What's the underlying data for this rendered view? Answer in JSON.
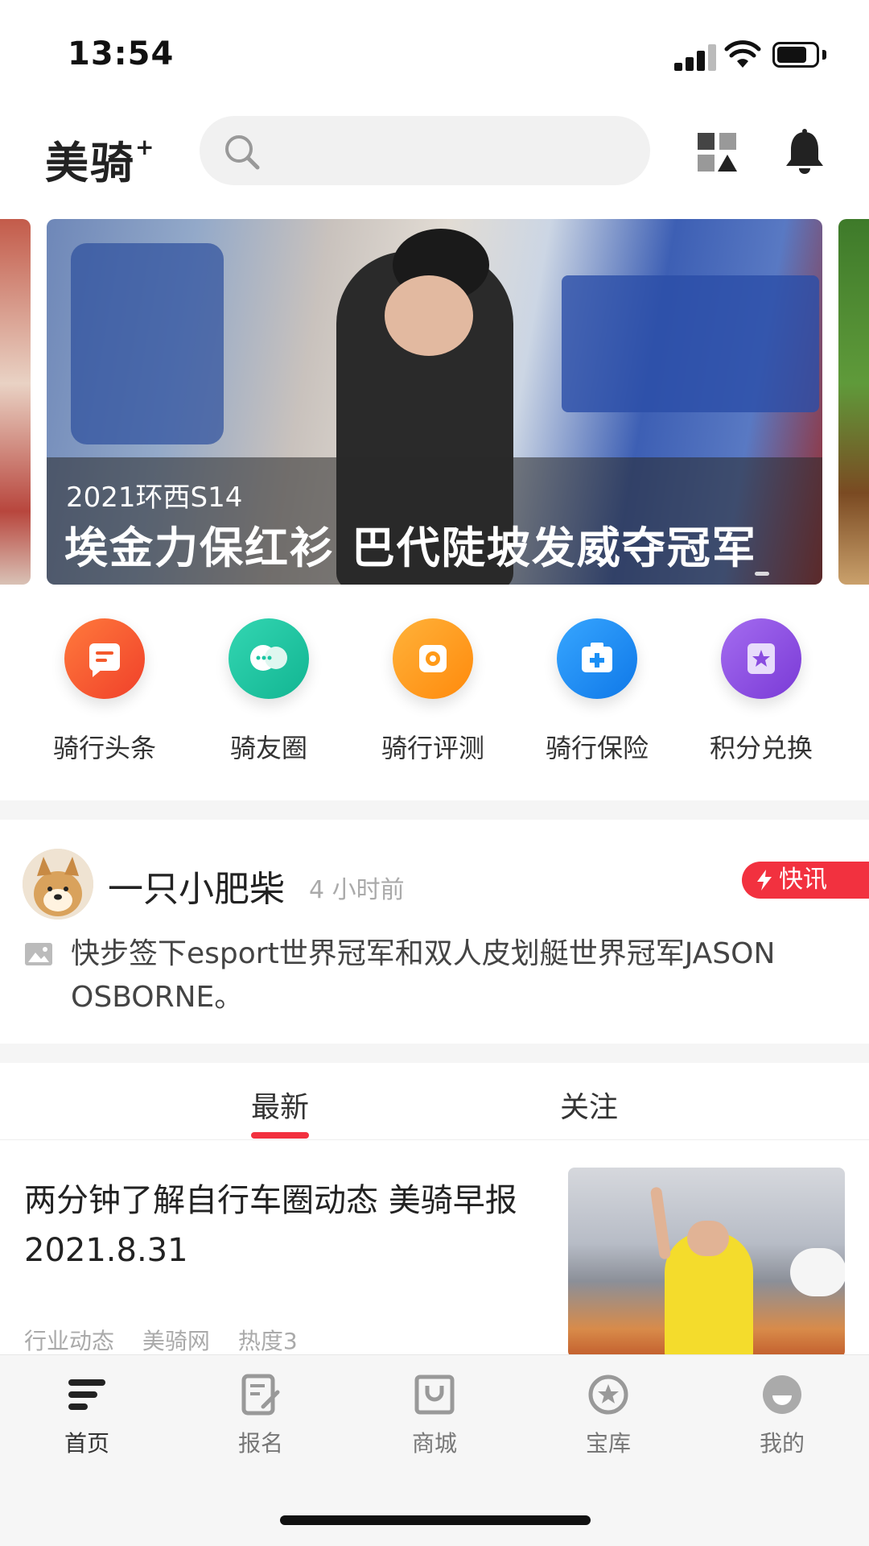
{
  "status_bar": {
    "time": "13:54"
  },
  "header": {
    "logo": "美骑",
    "logo_sup": "+",
    "search_placeholder": ""
  },
  "banner": {
    "subtitle": "2021环西S14",
    "title": "埃金力保红衫 巴代陡坡发威夺冠军"
  },
  "quick_nav": [
    {
      "label": "骑行头条",
      "icon": "news-icon",
      "color": "#f4582b"
    },
    {
      "label": "骑友圈",
      "icon": "chat-icon",
      "color": "#1cc6a3"
    },
    {
      "label": "骑行评测",
      "icon": "gear-icon",
      "color": "#ff9a18"
    },
    {
      "label": "骑行保险",
      "icon": "medkit-icon",
      "color": "#1b8ff5"
    },
    {
      "label": "积分兑换",
      "icon": "ticket-icon",
      "color": "#8a4ce0"
    }
  ],
  "flash_news": {
    "username": "一只小肥柴",
    "time": "4 小时前",
    "badge": "快讯",
    "text": "快步签下esport世界冠军和双人皮划艇世界冠军JASON OSBORNE。"
  },
  "tabs": [
    {
      "label": "最新",
      "active": true
    },
    {
      "label": "关注",
      "active": false
    }
  ],
  "article": {
    "title": "两分钟了解自行车圈动态 美骑早报2021.8.31",
    "meta": [
      "行业动态",
      "美骑网",
      "热度3"
    ]
  },
  "tabbar": [
    {
      "label": "首页",
      "icon": "home-icon",
      "active": true
    },
    {
      "label": "报名",
      "icon": "signup-icon",
      "active": false
    },
    {
      "label": "商城",
      "icon": "shop-icon",
      "active": false
    },
    {
      "label": "宝库",
      "icon": "treasure-icon",
      "active": false
    },
    {
      "label": "我的",
      "icon": "profile-icon",
      "active": false
    }
  ],
  "colors": {
    "accent": "#f2313f"
  }
}
